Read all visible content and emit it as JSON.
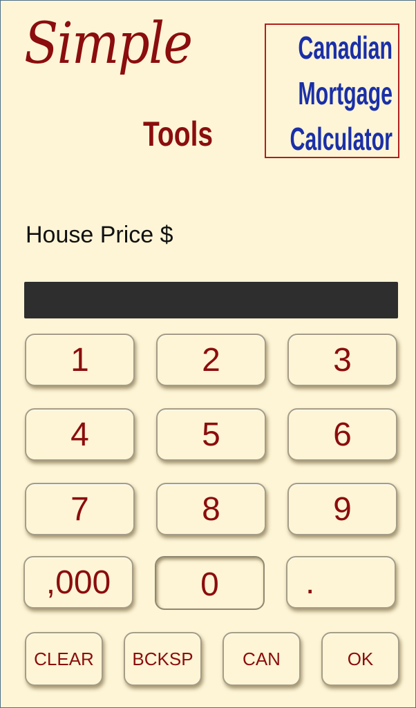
{
  "brand": {
    "simple": "Simple",
    "tools": "Tools"
  },
  "title": {
    "line1": "Canadian",
    "line2": "Mortgage",
    "line3": "Calculator"
  },
  "field": {
    "label": "House Price $",
    "value": ""
  },
  "keypad": {
    "k1": "1",
    "k2": "2",
    "k3": "3",
    "k4": "4",
    "k5": "5",
    "k6": "6",
    "k7": "7",
    "k8": "8",
    "k9": "9",
    "thousands": ",000",
    "zero": "0",
    "dot": "."
  },
  "actions": {
    "clear": "CLEAR",
    "backspace": "BCKSP",
    "cancel": "CAN",
    "ok": "OK"
  },
  "colors": {
    "background": "#fdf5d6",
    "brand_red": "#8b0d0d",
    "title_blue": "#1a2fa8",
    "display_bg": "#2e2e2e"
  }
}
